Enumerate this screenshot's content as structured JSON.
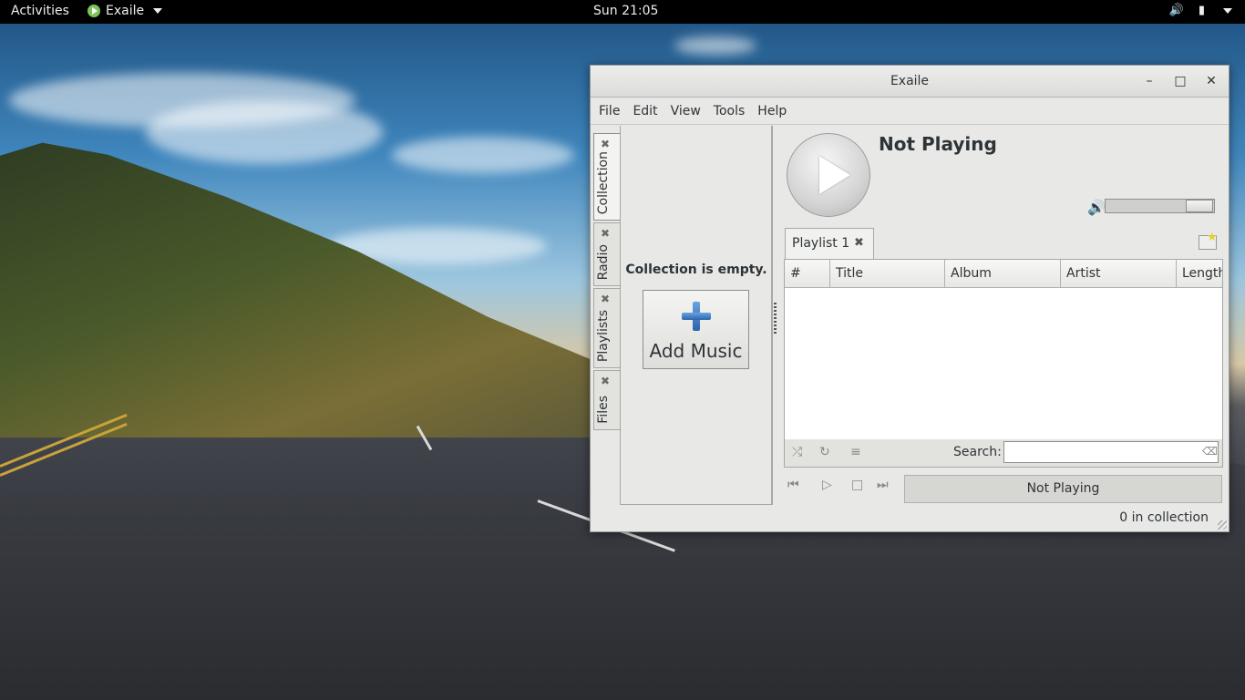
{
  "topbar": {
    "activities": "Activities",
    "app_name": "Exaile",
    "clock": "Sun 21:05",
    "tray_icons": [
      "volume-icon",
      "battery-icon"
    ]
  },
  "window": {
    "title": "Exaile",
    "buttons": [
      "minimize",
      "maximize",
      "close"
    ],
    "menu": [
      "File",
      "Edit",
      "View",
      "Tools",
      "Help"
    ]
  },
  "side_tabs": [
    {
      "label": "Collection",
      "active": true
    },
    {
      "label": "Radio",
      "active": false
    },
    {
      "label": "Playlists",
      "active": false
    },
    {
      "label": "Files",
      "active": false
    }
  ],
  "collection": {
    "empty_text": "Collection is empty.",
    "add_music_label": "Add Music"
  },
  "player": {
    "now_playing_title": "Not Playing",
    "volume": 0.85
  },
  "playlist": {
    "tab_label": "Playlist 1",
    "columns": [
      "#",
      "Title",
      "Album",
      "Artist",
      "Length"
    ],
    "search_label": "Search:",
    "search_value": ""
  },
  "status": {
    "now_playing": "Not Playing",
    "collection_count": "0 in collection"
  }
}
